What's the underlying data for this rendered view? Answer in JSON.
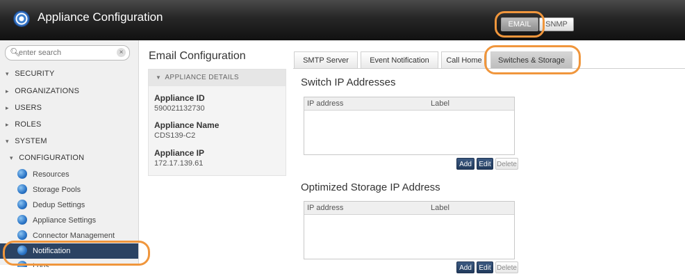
{
  "app": {
    "title": "Appliance Configuration"
  },
  "top_tabs": [
    {
      "label": "EMAIL",
      "selected": true
    },
    {
      "label": "SNMP",
      "selected": false
    }
  ],
  "sidebar": {
    "search_placeholder": "enter search",
    "clear_icon": "×",
    "items": [
      {
        "label": "SECURITY",
        "arrow": "▾"
      },
      {
        "label": "ORGANIZATIONS",
        "arrow": "▸"
      },
      {
        "label": "USERS",
        "arrow": "▸"
      },
      {
        "label": "ROLES",
        "arrow": "▸"
      },
      {
        "label": "SYSTEM",
        "arrow": "▾"
      },
      {
        "label": "CONFIGURATION",
        "arrow": "▾"
      }
    ],
    "sub_items": [
      {
        "label": "Resources"
      },
      {
        "label": "Storage Pools"
      },
      {
        "label": "Dedup Settings"
      },
      {
        "label": "Appliance Settings"
      },
      {
        "label": "Connector Management"
      },
      {
        "label": "Notification",
        "selected": true
      },
      {
        "label": "Logs"
      }
    ]
  },
  "config": {
    "title": "Email Configuration",
    "details_header": "APPLIANCE DETAILS",
    "fields": [
      {
        "label": "Appliance ID",
        "value": "590021132730"
      },
      {
        "label": "Appliance Name",
        "value": "CDS139-C2"
      },
      {
        "label": "Appliance IP",
        "value": "172.17.139.61"
      }
    ]
  },
  "tabs": [
    {
      "label": "SMTP Server"
    },
    {
      "label": "Event Notification"
    },
    {
      "label": "Call Home"
    },
    {
      "label": "Switches & Storage",
      "active": true
    }
  ],
  "switch_section": {
    "title": "Switch IP Addresses",
    "columns": [
      "IP address",
      "Label"
    ],
    "buttons": {
      "add": "Add",
      "edit": "Edit",
      "delete": "Delete"
    }
  },
  "storage_section": {
    "title": "Optimized Storage IP Address",
    "columns": [
      "IP address",
      "Label"
    ],
    "buttons": {
      "add": "Add",
      "edit": "Edit",
      "delete": "Delete"
    }
  },
  "colors": {
    "highlight_ring": "#f0963c",
    "selected_nav": "#2b4363",
    "primary_button": "#2b4a72"
  }
}
